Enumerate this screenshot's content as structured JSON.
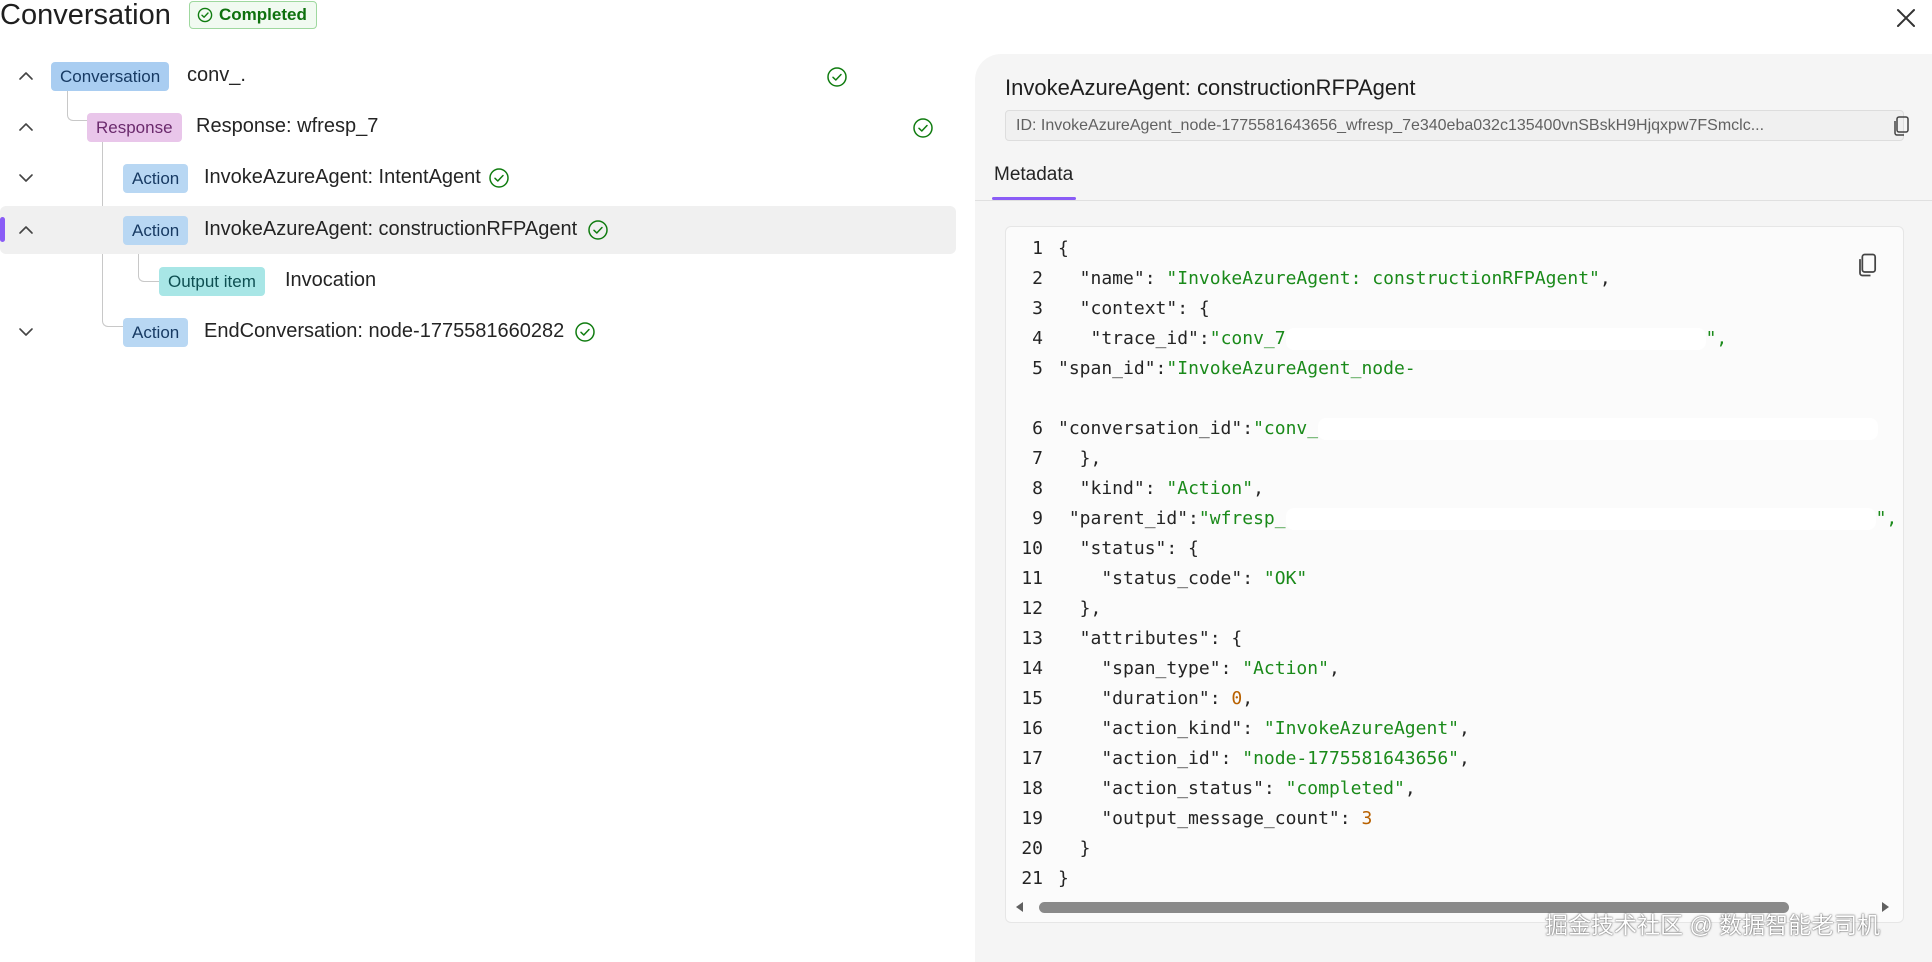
{
  "header": {
    "title": "Conversation",
    "status": "Completed"
  },
  "tree": {
    "rows": [
      {
        "badge": "Conversation",
        "label": "conv_."
      },
      {
        "badge": "Response",
        "label": "Response: wfresp_7"
      },
      {
        "badge": "Action",
        "label": "InvokeAzureAgent: IntentAgent"
      },
      {
        "badge": "Action",
        "label": "InvokeAzureAgent: constructionRFPAgent"
      },
      {
        "badge": "Output item",
        "label": "Invocation"
      },
      {
        "badge": "Action",
        "label": "EndConversation: node-1775581660282"
      }
    ]
  },
  "details": {
    "title": "InvokeAzureAgent: constructionRFPAgent",
    "id_text": "ID: InvokeAzureAgent_node-1775581643656_wfresp_7e340eba032c135400vnSBskH9Hjqxpw7FSmclc...",
    "tab": "Metadata"
  },
  "code": {
    "lines": [
      {
        "n": "1",
        "key": "",
        "sep": "{",
        "val": "",
        "vtype": "",
        "tail": ""
      },
      {
        "n": "2",
        "key": "  \"name\"",
        "sep": ": ",
        "val": "\"InvokeAzureAgent: constructionRFPAgent\"",
        "vtype": "s",
        "tail": ","
      },
      {
        "n": "3",
        "key": "  \"context\"",
        "sep": ": {",
        "val": "",
        "vtype": "",
        "tail": ""
      },
      {
        "n": "4",
        "key": "   \"trace_id\"",
        "sep": ":",
        "val": "\"conv_7",
        "vtype": "s",
        "tail": "\","
      },
      {
        "n": "5",
        "key": "\"span_id\"",
        "sep": ":",
        "val": "\"InvokeAzureAgent_node-",
        "vtype": "s",
        "tail": ""
      },
      {
        "n": "6",
        "key": "\"conversation_id\"",
        "sep": ":",
        "val": "\"conv_",
        "vtype": "s",
        "tail": ""
      },
      {
        "n": "7",
        "key": "  },",
        "sep": "",
        "val": "",
        "vtype": "",
        "tail": ""
      },
      {
        "n": "8",
        "key": "  \"kind\"",
        "sep": ": ",
        "val": "\"Action\"",
        "vtype": "s",
        "tail": ","
      },
      {
        "n": "9",
        "key": " \"parent_id\"",
        "sep": ":",
        "val": "\"wfresp_",
        "vtype": "s",
        "tail": "\","
      },
      {
        "n": "10",
        "key": "  \"status\"",
        "sep": ": {",
        "val": "",
        "vtype": "",
        "tail": ""
      },
      {
        "n": "11",
        "key": "    \"status_code\"",
        "sep": ": ",
        "val": "\"OK\"",
        "vtype": "s",
        "tail": ""
      },
      {
        "n": "12",
        "key": "  },",
        "sep": "",
        "val": "",
        "vtype": "",
        "tail": ""
      },
      {
        "n": "13",
        "key": "  \"attributes\"",
        "sep": ": {",
        "val": "",
        "vtype": "",
        "tail": ""
      },
      {
        "n": "14",
        "key": "    \"span_type\"",
        "sep": ": ",
        "val": "\"Action\"",
        "vtype": "s",
        "tail": ","
      },
      {
        "n": "15",
        "key": "    \"duration\"",
        "sep": ": ",
        "val": "0",
        "vtype": "n",
        "tail": ","
      },
      {
        "n": "16",
        "key": "    \"action_kind\"",
        "sep": ": ",
        "val": "\"InvokeAzureAgent\"",
        "vtype": "s",
        "tail": ","
      },
      {
        "n": "17",
        "key": "    \"action_id\"",
        "sep": ": ",
        "val": "\"node-1775581643656\"",
        "vtype": "s",
        "tail": ","
      },
      {
        "n": "18",
        "key": "    \"action_status\"",
        "sep": ": ",
        "val": "\"completed\"",
        "vtype": "s",
        "tail": ","
      },
      {
        "n": "19",
        "key": "    \"output_message_count\"",
        "sep": ": ",
        "val": "3",
        "vtype": "n",
        "tail": ""
      },
      {
        "n": "20",
        "key": "  }",
        "sep": "",
        "val": "",
        "vtype": "",
        "tail": ""
      },
      {
        "n": "21",
        "key": "}",
        "sep": "",
        "val": "",
        "vtype": "",
        "tail": ""
      }
    ]
  },
  "watermark": "掘金技术社区 @ 数据智能老司机",
  "colors": {
    "accent": "#8a5cf6",
    "success": "#107c10",
    "string": "#1a8a1a",
    "number": "#b86100"
  }
}
